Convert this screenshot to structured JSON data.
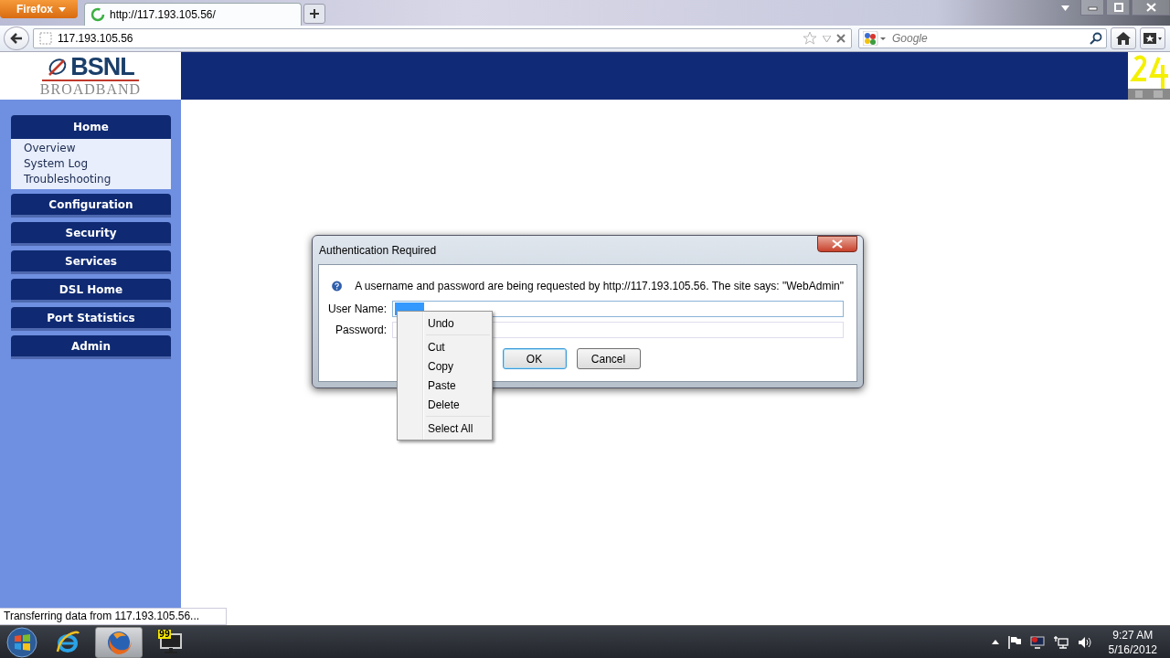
{
  "browser": {
    "app_button": "Firefox",
    "tabs": [
      {
        "title": "http://117.193.105.56/",
        "selected": true,
        "loading": true
      }
    ],
    "address": "117.193.105.56",
    "search": {
      "placeholder": "Google"
    }
  },
  "page": {
    "logo": {
      "name": "BSNL",
      "tagline": "BROADBAND"
    },
    "menu": [
      {
        "label": "Home",
        "expanded": true,
        "children": [
          {
            "label": "Overview"
          },
          {
            "label": "System Log"
          },
          {
            "label": "Troubleshooting"
          }
        ]
      },
      {
        "label": "Configuration",
        "expanded": false
      },
      {
        "label": "Security",
        "expanded": false
      },
      {
        "label": "Services",
        "expanded": false
      },
      {
        "label": "DSL Home",
        "expanded": false
      },
      {
        "label": "Port Statistics",
        "expanded": false
      },
      {
        "label": "Admin",
        "expanded": false
      }
    ]
  },
  "status_text": "Transferring data from 117.193.105.56...",
  "dialog": {
    "title": "Authentication Required",
    "message": "A username and password are being requested by http://117.193.105.56. The site says: \"WebAdmin\"",
    "fields": [
      {
        "label": "User Name:",
        "focused": true,
        "text_selected": true
      },
      {
        "label": "Password:",
        "focused": false
      }
    ],
    "buttons": [
      {
        "label": "OK",
        "default": true
      },
      {
        "label": "Cancel",
        "default": false
      }
    ]
  },
  "context_menu": {
    "items": [
      {
        "kind": "item",
        "label": "Undo"
      },
      {
        "kind": "separator"
      },
      {
        "kind": "item",
        "label": "Cut"
      },
      {
        "kind": "item",
        "label": "Copy"
      },
      {
        "kind": "item",
        "label": "Paste"
      },
      {
        "kind": "item",
        "label": "Delete"
      },
      {
        "kind": "separator"
      },
      {
        "kind": "item",
        "label": "Select All"
      }
    ]
  },
  "taskbar": {
    "apps": [
      {
        "kind": "ie",
        "active": false
      },
      {
        "kind": "firefox",
        "active": true
      },
      {
        "kind": "monitor",
        "active": false,
        "badge": "99"
      }
    ],
    "clock": {
      "time": "9:27 AM",
      "date": "5/16/2012"
    }
  }
}
